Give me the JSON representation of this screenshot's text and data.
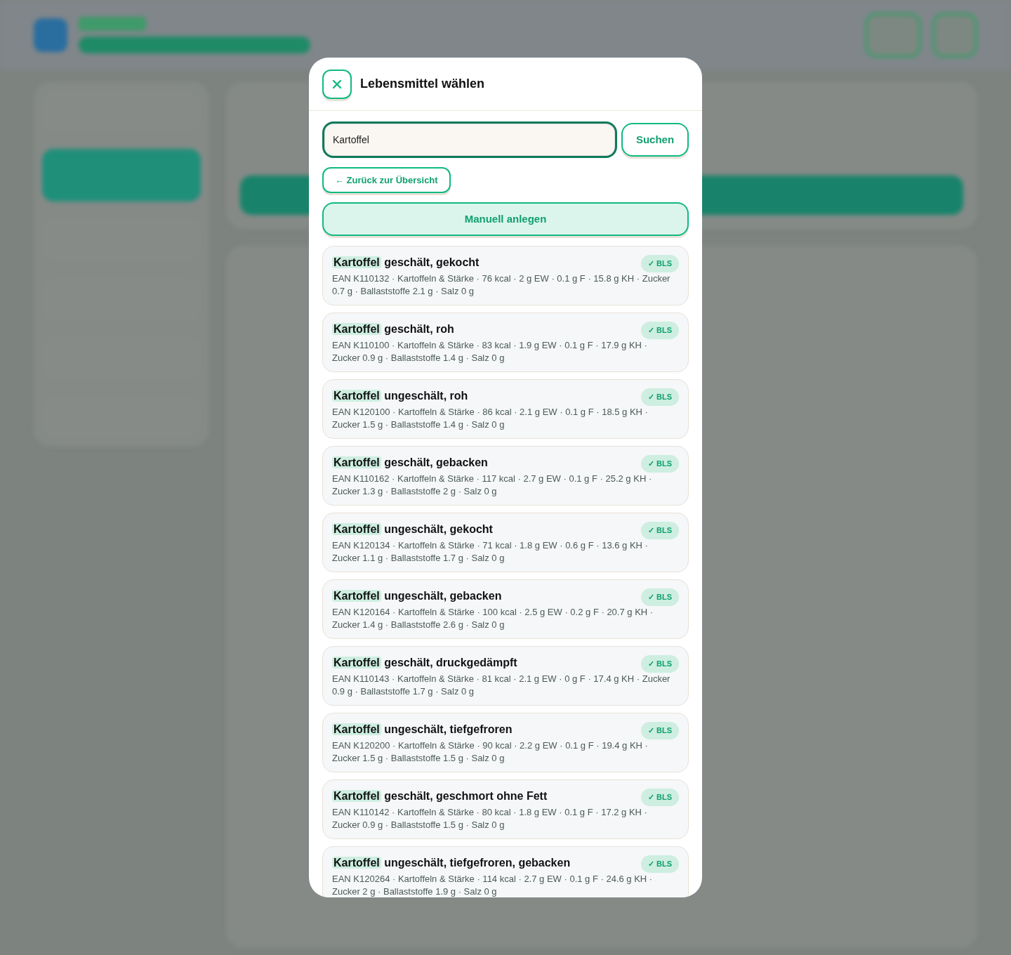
{
  "dialog": {
    "title": "Lebensmittel wählen",
    "search": {
      "value": "Kartoffel",
      "button": "Suchen"
    },
    "back_button": "← Zurück zur Übersicht",
    "manual_button": "Manuell anlegen",
    "results": [
      {
        "match": "Kartoffel",
        "name": "geschält, gekocht",
        "details": "EAN K110132 · Kartoffeln & Stärke · 76 kcal · 2 g EW · 0.1 g F · 15.8 g KH · Zucker 0.7 g · Ballaststoffe 2.1 g · Salz 0 g",
        "badge": "✓ BLS"
      },
      {
        "match": "Kartoffel",
        "name": "geschält, roh",
        "details": "EAN K110100 · Kartoffeln & Stärke · 83 kcal · 1.9 g EW · 0.1 g F · 17.9 g KH · Zucker 0.9 g · Ballaststoffe 1.4 g · Salz 0 g",
        "badge": "✓ BLS"
      },
      {
        "match": "Kartoffel",
        "name": "ungeschält, roh",
        "details": "EAN K120100 · Kartoffeln & Stärke · 86 kcal · 2.1 g EW · 0.1 g F · 18.5 g KH · Zucker 1.5 g · Ballaststoffe 1.4 g · Salz 0 g",
        "badge": "✓ BLS"
      },
      {
        "match": "Kartoffel",
        "name": "geschält, gebacken",
        "details": "EAN K110162 · Kartoffeln & Stärke · 117 kcal · 2.7 g EW · 0.1 g F · 25.2 g KH · Zucker 1.3 g · Ballaststoffe 2 g · Salz 0 g",
        "badge": "✓ BLS"
      },
      {
        "match": "Kartoffel",
        "name": "ungeschält, gekocht",
        "details": "EAN K120134 · Kartoffeln & Stärke · 71 kcal · 1.8 g EW · 0.6 g F · 13.6 g KH · Zucker 1.1 g · Ballaststoffe 1.7 g · Salz 0 g",
        "badge": "✓ BLS"
      },
      {
        "match": "Kartoffel",
        "name": "ungeschält, gebacken",
        "details": "EAN K120164 · Kartoffeln & Stärke · 100 kcal · 2.5 g EW · 0.2 g F · 20.7 g KH · Zucker 1.4 g · Ballaststoffe 2.6 g · Salz 0 g",
        "badge": "✓ BLS"
      },
      {
        "match": "Kartoffel",
        "name": "geschält, druckgedämpft",
        "details": "EAN K110143 · Kartoffeln & Stärke · 81 kcal · 2.1 g EW · 0 g F · 17.4 g KH · Zucker 0.9 g · Ballaststoffe 1.7 g · Salz 0 g",
        "badge": "✓ BLS"
      },
      {
        "match": "Kartoffel",
        "name": "ungeschält, tiefgefroren",
        "details": "EAN K120200 · Kartoffeln & Stärke · 90 kcal · 2.2 g EW · 0.1 g F · 19.4 g KH · Zucker 1.5 g · Ballaststoffe 1.5 g · Salz 0 g",
        "badge": "✓ BLS"
      },
      {
        "match": "Kartoffel",
        "name": "geschält, geschmort ohne Fett",
        "details": "EAN K110142 · Kartoffeln & Stärke · 80 kcal · 1.8 g EW · 0.1 g F · 17.2 g KH · Zucker 0.9 g · Ballaststoffe 1.5 g · Salz 0 g",
        "badge": "✓ BLS"
      },
      {
        "match": "Kartoffel",
        "name": "ungeschält, tiefgefroren, gebacken",
        "details": "EAN K120264 · Kartoffeln & Stärke · 114 kcal · 2.7 g EW · 0.1 g F · 24.6 g KH · Zucker 2 g · Ballaststoffe 1.9 g · Salz 0 g",
        "badge": "✓ BLS"
      }
    ]
  }
}
